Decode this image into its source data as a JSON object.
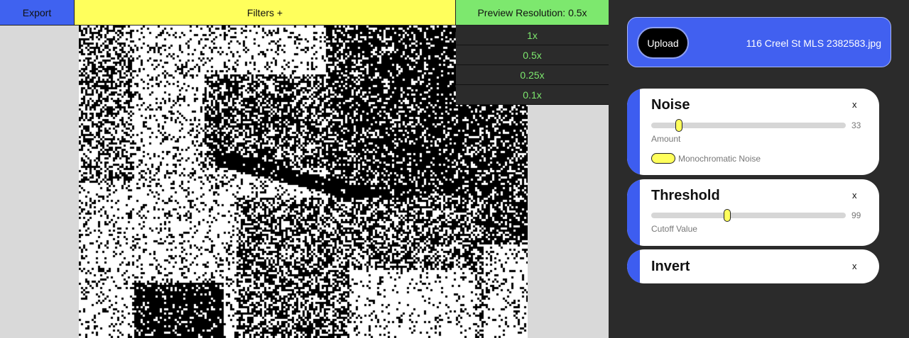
{
  "toolbar": {
    "export_label": "Export",
    "filters_label": "Filters +",
    "resolution_label": "Preview Resolution: 0.5x",
    "colors": {
      "export": "#3f62f0",
      "filters": "#ffff5c",
      "resolution": "#7de86e"
    }
  },
  "resolution_menu": {
    "options": [
      "1x",
      "0.5x",
      "0.25x",
      "0.1x"
    ],
    "selected": "0.5x"
  },
  "upload": {
    "button_label": "Upload",
    "file_name": "116 Creel St MLS 2382583.jpg"
  },
  "filters": [
    {
      "title": "Noise",
      "close_label": "x",
      "slider": {
        "value": "33",
        "label": "Amount",
        "max": 255
      },
      "toggle": {
        "label": "Monochromatic Noise",
        "on": true
      }
    },
    {
      "title": "Threshold",
      "close_label": "x",
      "slider": {
        "value": "99",
        "label": "Cutoff Value",
        "max": 255
      }
    },
    {
      "title": "Invert",
      "close_label": "x"
    }
  ],
  "accent_color": "#3d5df0",
  "panel_background": "#2b2b2b"
}
